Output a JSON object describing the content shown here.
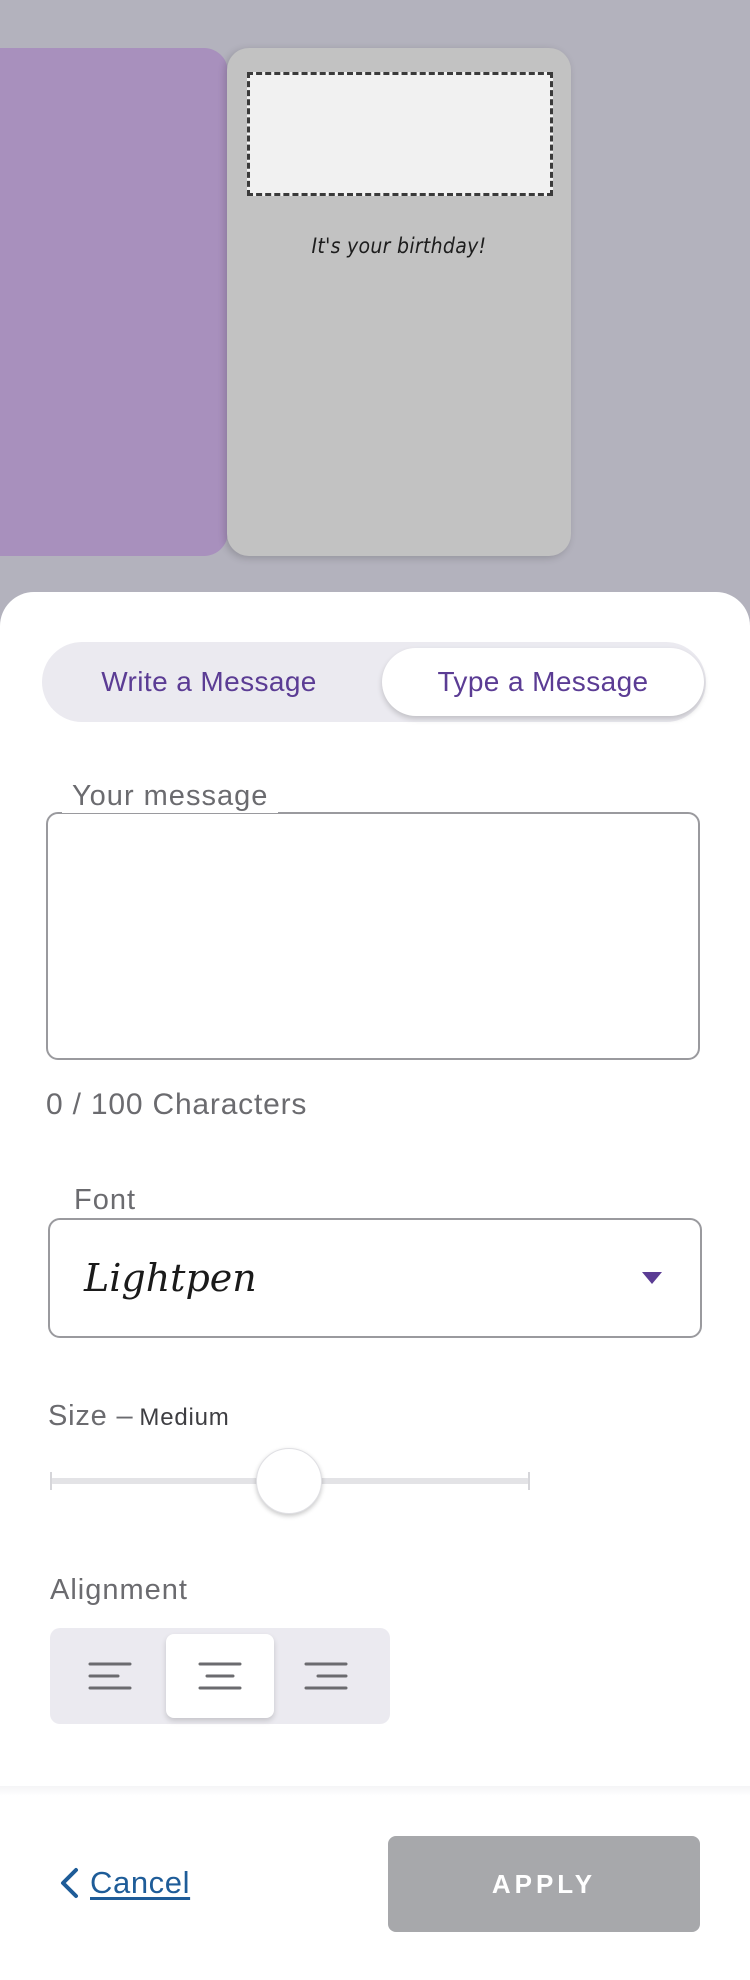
{
  "card": {
    "message_text": "It's your birthday!"
  },
  "mode_toggle": {
    "options": [
      "Write a Message",
      "Type a Message"
    ],
    "selected": "Type a Message"
  },
  "message_field": {
    "label": "Your message",
    "value": "",
    "char_count": "0 / 100 Characters"
  },
  "font_field": {
    "label": "Font",
    "value": "Lightpen"
  },
  "size": {
    "label": "Size –",
    "value": "Medium",
    "level": 0.5
  },
  "alignment": {
    "label": "Alignment",
    "options": [
      "left",
      "center",
      "right"
    ],
    "selected": "center"
  },
  "footer": {
    "cancel_label": "Cancel",
    "apply_label": "APPLY"
  },
  "colors": {
    "accent": "#5b3c94",
    "link": "#1e5c98",
    "card_left": "#a890bd",
    "card_right": "#c2c2c2",
    "disabled_button": "#a7a8ab"
  }
}
